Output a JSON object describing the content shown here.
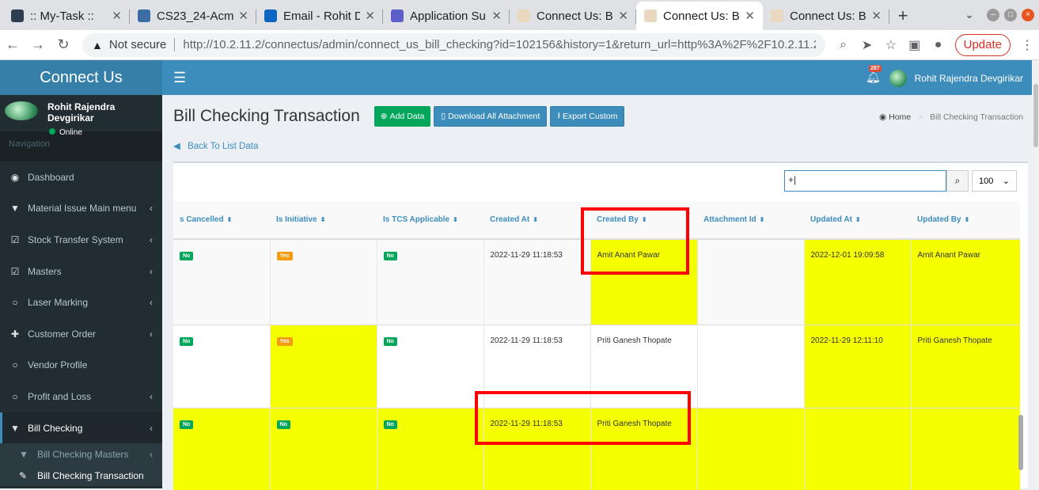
{
  "browser": {
    "tabs": [
      {
        "title": ":: My-Task ::",
        "fav_color": "#2c3e50",
        "icon": "react-icon"
      },
      {
        "title": "CS23_24-Acme",
        "fav_color": "#3a6ea5",
        "icon": "grid-icon"
      },
      {
        "title": "Email - Rohit D",
        "fav_color": "#0a66c2",
        "icon": "outlook-icon"
      },
      {
        "title": "Application Su",
        "fav_color": "#5b5fc7",
        "icon": "teams-icon"
      },
      {
        "title": "Connect Us: B",
        "fav_color": "#e8d8c0",
        "icon": "connect-icon"
      },
      {
        "title": "Connect Us: B",
        "fav_color": "#e8d8c0",
        "icon": "connect-icon",
        "active": true
      },
      {
        "title": "Connect Us: B",
        "fav_color": "#e8d8c0",
        "icon": "connect-icon"
      }
    ],
    "not_secure": "Not secure",
    "url": "http://10.2.11.2/connectus/admin/connect_us_bill_checking?id=102156&history=1&return_url=http%3A%2F%2F10.2.11.2%2...",
    "update_label": "Update"
  },
  "sidebar": {
    "logo": "Connect Us",
    "user_name": "Rohit Rajendra Devgirikar",
    "user_status": "Online",
    "nav_header": "Navigation",
    "items": [
      {
        "label": "Dashboard",
        "icon": "dashboard-icon",
        "glyph": "◉",
        "arrow": false
      },
      {
        "label": "Material Issue Main menu",
        "icon": "filter-icon",
        "glyph": "▼",
        "arrow": true
      },
      {
        "label": "Stock Transfer System",
        "icon": "checkbox-icon",
        "glyph": "☑",
        "arrow": true
      },
      {
        "label": "Masters",
        "icon": "checkbox-icon",
        "glyph": "☑",
        "arrow": true
      },
      {
        "label": "Laser Marking",
        "icon": "circle-icon",
        "glyph": "○",
        "arrow": true
      },
      {
        "label": "Customer Order",
        "icon": "plus-icon",
        "glyph": "✚",
        "arrow": true
      },
      {
        "label": "Vendor Profile",
        "icon": "circle-icon",
        "glyph": "○",
        "arrow": false
      },
      {
        "label": "Profit and Loss",
        "icon": "circle-icon",
        "glyph": "○",
        "arrow": true
      },
      {
        "label": "Bill Checking",
        "icon": "filter-icon",
        "glyph": "▼",
        "arrow": true,
        "active": true
      }
    ],
    "sub_items": [
      {
        "label": "Bill Checking Masters",
        "icon": "filter-icon",
        "glyph": "▼",
        "arrow": true
      },
      {
        "label": "Bill Checking Transaction",
        "icon": "pencil-icon",
        "glyph": "✎",
        "arrow": false,
        "active": true
      }
    ]
  },
  "topnav": {
    "notification_count": "287",
    "user_name": "Rohit Rajendra Devgirikar"
  },
  "page": {
    "title": "Bill Checking Transaction",
    "buttons": {
      "add": "Add Data",
      "download": "Download All Attachment",
      "export": "Export Custom"
    },
    "breadcrumb": {
      "home": "Home",
      "current": "Bill Checking Transaction"
    },
    "back_link": "Back To List Data",
    "search_value": "+|",
    "page_size": "100"
  },
  "table": {
    "columns": [
      "s Cancelled",
      "Is Initiative",
      "Is TCS Applicable",
      "Created At",
      "Created By",
      "Attachment Id",
      "Updated At",
      "Updated By"
    ],
    "rows": [
      {
        "cells": [
          {
            "badge": "No",
            "color": "green"
          },
          {
            "badge": "Yes",
            "color": "orange"
          },
          {
            "badge": "No",
            "color": "green"
          },
          {
            "text": "2022-11-29 11:18:53"
          },
          {
            "text": "Amit Anant Pawar",
            "highlight": true
          },
          {
            "text": "",
            "highlight": false
          },
          {
            "text": "2022-12-01 19:09:58",
            "highlight": true
          },
          {
            "text": "Amit Anant Pawar",
            "highlight": true
          }
        ]
      },
      {
        "cells": [
          {
            "badge": "No",
            "color": "green"
          },
          {
            "badge": "Yes",
            "color": "orange",
            "highlight": true
          },
          {
            "badge": "No",
            "color": "green"
          },
          {
            "text": "2022-11-29 11:18:53"
          },
          {
            "text": "Priti Ganesh Thopate"
          },
          {
            "text": ""
          },
          {
            "text": "2022-11-29 12:11:10",
            "highlight": true
          },
          {
            "text": "Priti Ganesh Thopate",
            "highlight": true
          }
        ]
      },
      {
        "cells": [
          {
            "badge": "No",
            "color": "green",
            "highlight": true
          },
          {
            "badge": "No",
            "color": "green",
            "highlight": true
          },
          {
            "badge": "No",
            "color": "green",
            "highlight": true
          },
          {
            "text": "2022-11-29 11:18:53",
            "highlight": true
          },
          {
            "text": "Priti Ganesh Thopate",
            "highlight": true
          },
          {
            "text": "",
            "highlight": true
          },
          {
            "text": "",
            "highlight": true
          },
          {
            "text": "",
            "highlight": true
          }
        ]
      }
    ]
  },
  "colors": {
    "highlight": "#f6ff00",
    "annotation": "#ff0000",
    "accent": "#3c8dbc"
  }
}
